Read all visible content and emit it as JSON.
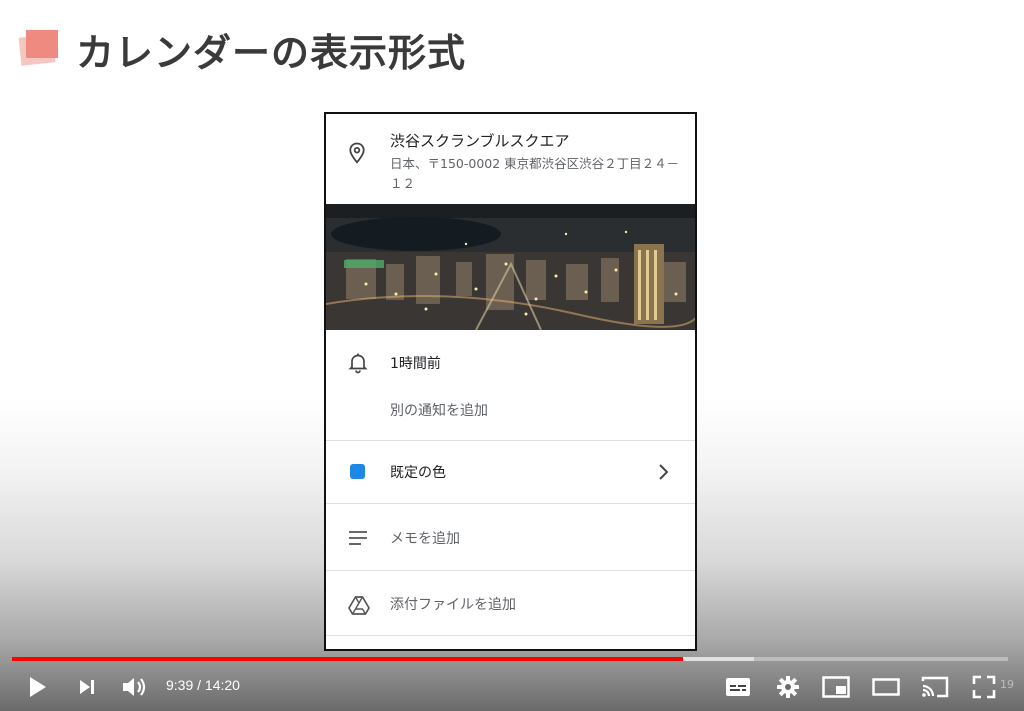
{
  "slide": {
    "title": "カレンダーの表示形式",
    "accent_color": "#ef8a80"
  },
  "event_detail": {
    "location": {
      "icon": "map-pin-icon",
      "name": "渋谷スクランブルスクエア",
      "address": "日本、〒150-0002 東京都渋谷区渋谷２丁目２４－１２"
    },
    "photo": {
      "alt": "night-city-view-photo"
    },
    "notification": {
      "icon": "bell-icon",
      "label": "1時間前",
      "add_label": "別の通知を追加"
    },
    "color": {
      "swatch_color": "#1e88e5",
      "label": "既定の色",
      "icon": "chevron-right-icon"
    },
    "memo": {
      "icon": "notes-icon",
      "label": "メモを追加"
    },
    "attachment": {
      "icon": "drive-icon",
      "label": "添付ファイルを追加"
    }
  },
  "player": {
    "time": "9:39 / 14:20",
    "played_fraction": 0.674,
    "buffered_fraction": 0.745,
    "progress_color": "#ff0000",
    "corner_text": "19"
  }
}
